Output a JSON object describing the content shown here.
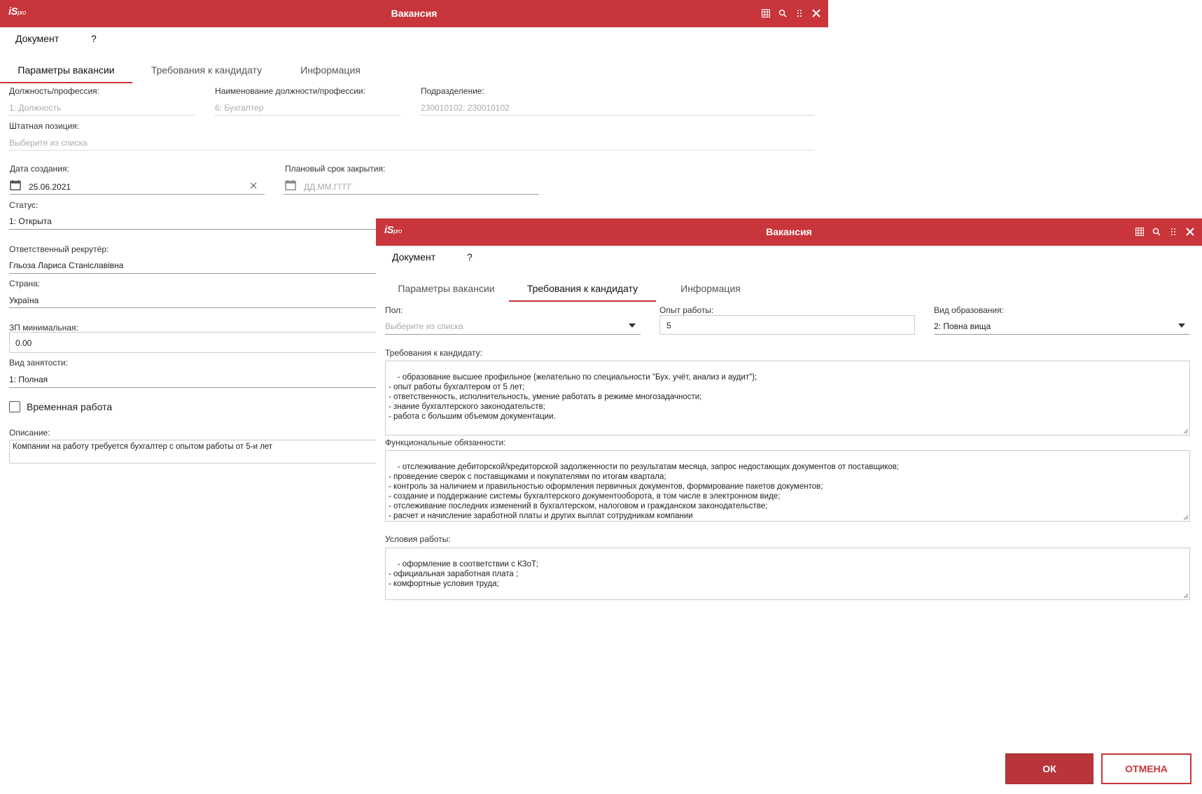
{
  "back_window": {
    "title": "Вакансия",
    "logo": "iS",
    "logo_suffix": "pro",
    "menu": [
      "Документ",
      "?"
    ],
    "tabs": [
      "Параметры вакансии",
      "Требования к кандидату",
      "Информация"
    ],
    "active_tab": 0,
    "fields": {
      "position_label": "Должность/профессия:",
      "position_value": "1: Должность",
      "position_name_label": "Наименование должности/профессии:",
      "position_name_value": "6: Бухгалтер",
      "department_label": "Подразделение:",
      "department_value": "230010102: 230010102",
      "staff_position_label": "Штатная позиция:",
      "staff_position_placeholder": "Выберите из списка",
      "created_label": "Дата создания:",
      "created_value": "25.06.2021",
      "close_date_label": "Плановый срок закрытия:",
      "close_date_placeholder": "ДД.ММ.ГГГГ",
      "status_label": "Статус:",
      "status_value": "1: Открыта",
      "recruiter_label": "Ответственный рекрутёр:",
      "recruiter_value": "Гльоза Лариса Станіславівна",
      "country_label": "Страна:",
      "country_value": "Україна",
      "salary_min_label": "ЗП минимальная:",
      "salary_min_value": "0.00",
      "employment_label": "Вид занятости:",
      "employment_value": "1: Полная",
      "temp_work_label": "Временная работа",
      "description_label": "Описание:",
      "description_value": "Компании на работу требуется бухгалтер с опытом работы от 5-и лет"
    }
  },
  "front_window": {
    "title": "Вакансия",
    "logo": "iS",
    "logo_suffix": "pro",
    "menu": [
      "Документ",
      "?"
    ],
    "tabs": [
      "Параметры вакансии",
      "Требования к кандидату",
      "Информация"
    ],
    "active_tab": 1,
    "fields": {
      "gender_label": "Пол:",
      "gender_placeholder": "Выберите из списка",
      "experience_label": "Опыт работы:",
      "experience_value": "5",
      "education_label": "Вид образования:",
      "education_value": "2: Повна вища",
      "requirements_label": "Требования к кандидату:",
      "requirements_value": "- образование высшее профильное (желательно по специальности \"Бух. учёт, анализ и аудит\");\n- опыт работы бухгалтером от 5 лет;\n- ответственность, исполнительность, умение работать в режиме многозадачности;\n- знание бухгалтерского законодательств;\n- работа с большим объемом документации.",
      "duties_label": "Функциональные обязанности:",
      "duties_value": "- отслеживание дебиторской/кредиторской задолженности по результатам месяца, запрос недостающих документов от поставщиков;\n- проведение сверок с поставщиками и покупателями по итогам квартала;\n- контроль за наличием и правильностью оформления первичных документов, формирование пакетов документов;\n- создание и поддержание системы бухгалтерского документооборота, в том числе в электронном виде;\n- отслеживание последних изменений в бухгалтерском, налоговом и гражданском законодательстве;\n- расчет и начисление заработной платы и других выплат сотрудникам компании",
      "conditions_label": "Условия работы:",
      "conditions_value": "- оформление в соответствии с КЗоТ;\n- официальная заработная плата ;\n- комфортные условия труда;"
    },
    "buttons": {
      "ok": "ОК",
      "cancel": "ОТМЕНА"
    }
  },
  "colors": {
    "accent": "#c8353b",
    "ok_bg": "#b8353a"
  }
}
